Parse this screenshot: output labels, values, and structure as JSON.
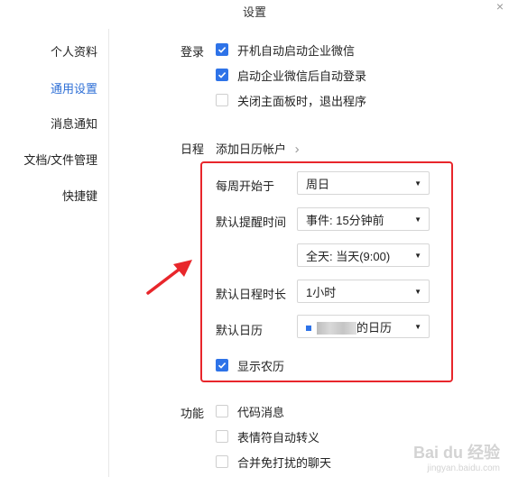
{
  "window": {
    "title": "设置",
    "close_glyph": "×"
  },
  "sidebar": {
    "items": [
      {
        "label": "个人资料",
        "active": false
      },
      {
        "label": "通用设置",
        "active": true
      },
      {
        "label": "消息通知",
        "active": false
      },
      {
        "label": "文档/文件管理",
        "active": false
      },
      {
        "label": "快捷键",
        "active": false
      }
    ]
  },
  "login": {
    "label": "登录",
    "options": [
      {
        "label": "开机自动启动企业微信",
        "checked": true
      },
      {
        "label": "启动企业微信后自动登录",
        "checked": true
      },
      {
        "label": "关闭主面板时，退出程序",
        "checked": false
      }
    ]
  },
  "calendar": {
    "label": "日程",
    "add_account": "添加日历帐户",
    "add_account_chevron": "›",
    "week_start_label": "每周开始于",
    "week_start_value": "周日",
    "reminder_label": "默认提醒时间",
    "reminder_event_value": "事件: 15分钟前",
    "reminder_allday_value": "全天: 当天(9:00)",
    "duration_label": "默认日程时长",
    "duration_value": "1小时",
    "default_calendar_label": "默认日历",
    "default_calendar_value": "的日历",
    "show_lunar_label": "显示农历",
    "show_lunar_checked": true
  },
  "features": {
    "label": "功能",
    "options": [
      {
        "label": "代码消息",
        "checked": false
      },
      {
        "label": "表情符自动转义",
        "checked": false
      },
      {
        "label": "合并免打扰的聊天",
        "checked": false
      }
    ]
  },
  "watermark": {
    "text": "Bai du 经验",
    "sub": "jingyan.baidu.com"
  },
  "colors": {
    "accent": "#2e73e8",
    "active_nav": "#2e6fd6",
    "highlight": "#e8262b"
  },
  "icons": {
    "caret": "caret-down-icon",
    "check": "check-icon",
    "arrow": "red-arrow-icon"
  }
}
